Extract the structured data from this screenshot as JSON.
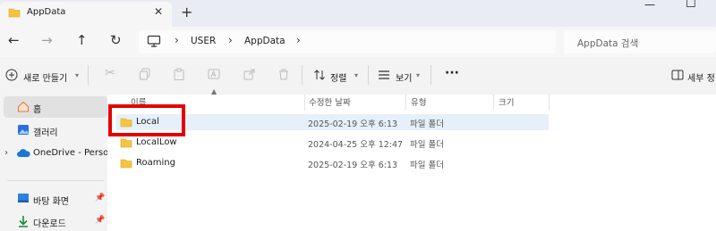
{
  "tab": {
    "title": "AppData",
    "close": "✕",
    "new": "+"
  },
  "window": {
    "min": "—",
    "max": "☐"
  },
  "nav": {
    "back": "←",
    "forward": "→",
    "up": "↑",
    "refresh": "↻"
  },
  "breadcrumb": {
    "computer": "USER",
    "folder": "AppData",
    "sep": "›"
  },
  "search": {
    "placeholder": "AppData 검색"
  },
  "toolbar": {
    "new": "새로 만들기",
    "sort": "정렬",
    "view": "보기",
    "more": "···",
    "details": "세부 정"
  },
  "sidebar": {
    "items": [
      {
        "label": "홈"
      },
      {
        "label": "갤러리"
      },
      {
        "label": "OneDrive - Persona"
      },
      {
        "label": "바탕 화면"
      },
      {
        "label": "다운로드"
      }
    ]
  },
  "columns": {
    "name": "이름",
    "date": "수정한 날짜",
    "type": "유형",
    "size": "크기"
  },
  "files": [
    {
      "name": "Local",
      "date": "2025-02-19 오후 6:13",
      "type": "파일 폴더"
    },
    {
      "name": "LocalLow",
      "date": "2024-04-25 오후 12:47",
      "type": "파일 폴더"
    },
    {
      "name": "Roaming",
      "date": "2025-02-19 오후 6:13",
      "type": "파일 폴더"
    }
  ],
  "colors": {
    "folder": "#f5c542",
    "selection": "#e5f0fb",
    "annotation": "#e40000"
  }
}
